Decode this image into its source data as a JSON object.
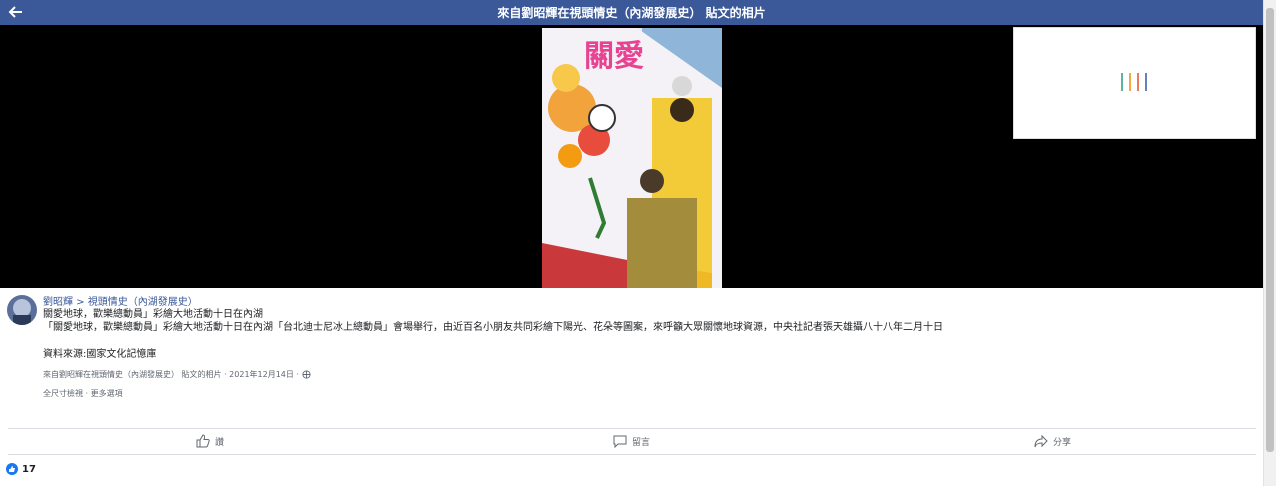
{
  "header": {
    "title": "來自劉昭輝在視頭情史（內湖發展史） 貼文的相片",
    "back_icon": "arrow-left-icon"
  },
  "post": {
    "author": "劉昭輝 > 視頭情史（內湖發展史）",
    "lines": [
      "關愛地球，歡樂總動員」彩繪大地活動十日在內湖",
      "「關愛地球，歡樂總動員」彩繪大地活動十日在內湖「台北迪士尼冰上總動員」會場舉行，由近百名小朋友共同彩繪下陽光、花朵等圖案，來呼籲大眾關懷地球資源，中央社記者張天雄攝八十八年二月十日",
      "資料來源:國家文化記憶庫"
    ],
    "meta": "來自劉昭輝在視頭情史（內湖發展史） 貼文的相片 · 2021年12月14日 ·",
    "links": "全尺寸檢視 · 更多選項"
  },
  "actions": {
    "like": "讚",
    "comment": "留言",
    "share": "分享"
  },
  "reactions": {
    "count": "17"
  },
  "photo_text": {
    "banner": "關愛"
  },
  "colors": {
    "header": "#3b5998",
    "link": "#385898",
    "like_blue": "#1877f2"
  }
}
